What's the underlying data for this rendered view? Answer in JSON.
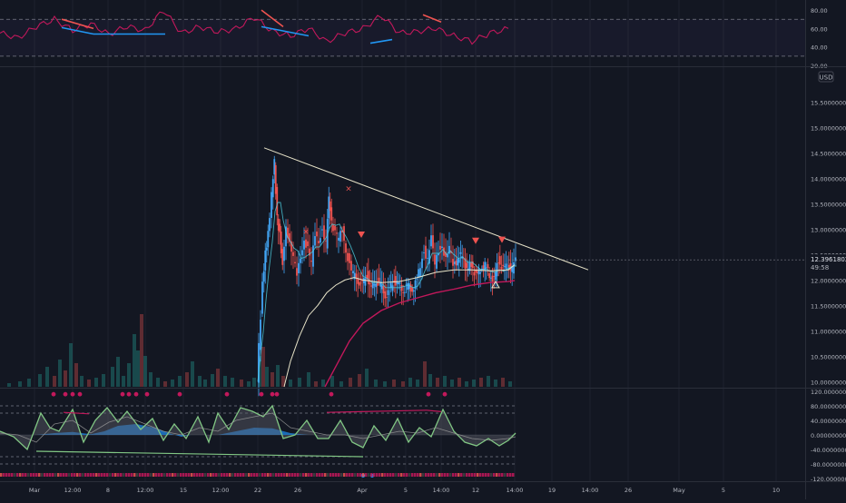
{
  "currency": "USD",
  "price_badge": {
    "price": "12.39618025",
    "countdown": "49:58"
  },
  "colors": {
    "background": "#131722",
    "grid": "#1e222d",
    "text": "#b2b5be",
    "up": "#26a69a",
    "down": "#ef5350",
    "rsi": "#c2185b",
    "div_bull": "#2196f3",
    "trendline": "#e8e4c9",
    "ma_slow": "#c2185b",
    "ma_mid": "#e8e4c9",
    "osc_green": "#81c784",
    "osc_blue": "#1e88e5",
    "price_badge": "#131722"
  },
  "chart_data": [
    {
      "type": "line",
      "panel": "rsi",
      "ylim": [
        20,
        85
      ],
      "y_ticks": [
        "80.00",
        "60.00",
        "40.00",
        "20.00"
      ],
      "levels": [
        70,
        30
      ],
      "x": [
        0,
        20,
        40,
        60,
        80,
        100,
        120,
        140,
        160,
        180,
        200,
        220,
        240,
        260,
        280,
        300,
        320,
        340,
        360,
        380,
        400,
        420,
        440,
        460,
        480,
        500,
        520,
        540,
        560
      ],
      "values": [
        55,
        50,
        62,
        70,
        58,
        65,
        54,
        62,
        58,
        80,
        55,
        62,
        56,
        60,
        72,
        57,
        52,
        60,
        46,
        55,
        60,
        74,
        55,
        57,
        60,
        52,
        46,
        55,
        60
      ],
      "divergences": [
        {
          "color": "bearish",
          "x": [
            68,
            103
          ],
          "values": [
            70,
            60
          ]
        },
        {
          "color": "bullish",
          "x": [
            68,
            103
          ],
          "values": [
            61,
            54
          ]
        },
        {
          "color": "bullish",
          "x": [
            103,
            182
          ],
          "values": [
            54,
            54
          ]
        },
        {
          "color": "bearish",
          "x": [
            288,
            312
          ],
          "values": [
            80,
            62
          ]
        },
        {
          "color": "bullish",
          "x": [
            288,
            340
          ],
          "values": [
            62,
            52
          ]
        },
        {
          "color": "bullish",
          "x": [
            408,
            432
          ],
          "values": [
            44,
            48
          ]
        },
        {
          "color": "bearish",
          "x": [
            466,
            486
          ],
          "values": [
            75,
            67
          ]
        }
      ]
    },
    {
      "type": "candlestick",
      "panel": "price",
      "ylim": [
        9.9,
        16.15
      ],
      "y_ticks": [
        "15.50000000",
        "15.00000000",
        "14.50000000",
        "14.00000000",
        "13.50000000",
        "13.00000000",
        "12.50000000",
        "12.00000000",
        "11.50000000",
        "11.00000000",
        "10.50000000",
        "10.00000000"
      ],
      "x_ticks": [
        {
          "label": "Mar",
          "x": 38
        },
        {
          "label": "12:00",
          "x": 80
        },
        {
          "label": "8",
          "x": 119
        },
        {
          "label": "12:00",
          "x": 160
        },
        {
          "label": "15",
          "x": 202
        },
        {
          "label": "12:00",
          "x": 243
        },
        {
          "label": "22",
          "x": 284
        },
        {
          "label": "26",
          "x": 328
        },
        {
          "label": "Apr",
          "x": 399
        },
        {
          "label": "5",
          "x": 447
        },
        {
          "label": "14:00",
          "x": 486
        },
        {
          "label": "12",
          "x": 524
        },
        {
          "label": "14:00",
          "x": 567
        },
        {
          "label": "19",
          "x": 608
        },
        {
          "label": "14:00",
          "x": 650
        },
        {
          "label": "26",
          "x": 692
        },
        {
          "label": "May",
          "x": 748
        },
        {
          "label": "5",
          "x": 797
        },
        {
          "label": "10",
          "x": 855
        }
      ],
      "price_path": {
        "x": [
          284,
          286,
          288,
          290,
          293,
          296,
          300,
          303,
          306,
          309,
          312,
          316,
          320,
          324,
          328,
          332,
          336,
          340,
          344,
          348,
          352,
          356,
          360,
          363,
          366,
          370,
          374,
          378,
          382,
          386,
          390,
          395,
          400,
          405,
          410,
          415,
          420,
          425,
          430,
          435,
          440,
          445,
          450,
          455,
          460,
          464,
          468,
          472,
          476,
          480,
          484,
          488,
          492,
          496,
          500,
          505,
          510,
          515,
          520,
          525,
          530,
          535,
          540,
          545,
          550,
          555,
          560,
          565,
          569
        ],
        "values": [
          10.0,
          10.7,
          11.3,
          11.9,
          12.5,
          12.9,
          13.7,
          14.3,
          13.2,
          12.9,
          12.3,
          13.1,
          12.7,
          12.4,
          12.1,
          12.5,
          12.8,
          12.6,
          12.3,
          12.9,
          12.8,
          13.0,
          12.7,
          13.6,
          13.1,
          12.9,
          12.8,
          13.0,
          12.6,
          12.3,
          12.1,
          12.0,
          11.9,
          12.1,
          11.8,
          12.0,
          11.9,
          11.7,
          11.8,
          12.0,
          11.9,
          11.8,
          11.9,
          11.8,
          12.0,
          12.3,
          12.6,
          12.4,
          12.8,
          12.3,
          12.6,
          12.7,
          12.4,
          12.6,
          12.3,
          12.4,
          12.5,
          12.2,
          12.3,
          12.1,
          12.2,
          12.3,
          12.1,
          12.0,
          12.4,
          12.2,
          12.3,
          12.2,
          12.4
        ]
      },
      "ma_slow": {
        "x": [
          358,
          370,
          385,
          400,
          420,
          440,
          460,
          480,
          500,
          520,
          540,
          560,
          567
        ],
        "values": [
          9.9,
          10.3,
          10.8,
          11.15,
          11.4,
          11.55,
          11.65,
          11.75,
          11.82,
          11.9,
          11.95,
          11.97,
          11.99
        ]
      },
      "ma_mid": {
        "x": [
          313,
          320,
          330,
          340,
          350,
          360,
          370,
          380,
          390,
          400,
          420,
          440,
          460,
          480,
          500,
          520,
          540,
          560,
          567
        ],
        "values": [
          9.9,
          10.4,
          10.9,
          11.3,
          11.5,
          11.75,
          11.9,
          12.0,
          12.05,
          12.0,
          11.95,
          11.97,
          12.05,
          12.15,
          12.2,
          12.2,
          12.18,
          12.2,
          12.3
        ]
      },
      "trendline": {
        "x": [
          291,
          648
        ],
        "values": [
          14.6,
          12.2
        ]
      },
      "markers": [
        {
          "symbol": "x",
          "x": 337,
          "value": 12.95
        },
        {
          "symbol": "x",
          "x": 384,
          "value": 13.8
        },
        {
          "symbol": "triangle-down",
          "x": 398,
          "value": 12.9
        },
        {
          "symbol": "triangle-down",
          "x": 524,
          "value": 12.78
        },
        {
          "symbol": "triangle-down",
          "x": 553,
          "value": 12.8
        },
        {
          "symbol": "triangle-up",
          "x": 546,
          "value": 11.92
        }
      ],
      "volume": [
        {
          "x": 10,
          "h": 4
        },
        {
          "x": 22,
          "h": 6
        },
        {
          "x": 32,
          "h": 9
        },
        {
          "x": 44,
          "h": 14
        },
        {
          "x": 52,
          "h": 22
        },
        {
          "x": 60,
          "h": 12
        },
        {
          "x": 66,
          "h": 30
        },
        {
          "x": 72,
          "h": 18
        },
        {
          "x": 78,
          "h": 48
        },
        {
          "x": 84,
          "h": 26
        },
        {
          "x": 90,
          "h": 12
        },
        {
          "x": 98,
          "h": 8
        },
        {
          "x": 106,
          "h": 10
        },
        {
          "x": 114,
          "h": 14
        },
        {
          "x": 124,
          "h": 22
        },
        {
          "x": 130,
          "h": 33
        },
        {
          "x": 136,
          "h": 12
        },
        {
          "x": 142,
          "h": 26
        },
        {
          "x": 148,
          "h": 58
        },
        {
          "x": 152,
          "h": 40
        },
        {
          "x": 156,
          "h": 80
        },
        {
          "x": 160,
          "h": 34
        },
        {
          "x": 166,
          "h": 16
        },
        {
          "x": 174,
          "h": 10
        },
        {
          "x": 182,
          "h": 6
        },
        {
          "x": 190,
          "h": 8
        },
        {
          "x": 198,
          "h": 12
        },
        {
          "x": 206,
          "h": 16
        },
        {
          "x": 212,
          "h": 28
        },
        {
          "x": 220,
          "h": 12
        },
        {
          "x": 226,
          "h": 8
        },
        {
          "x": 234,
          "h": 14
        },
        {
          "x": 240,
          "h": 20
        },
        {
          "x": 248,
          "h": 12
        },
        {
          "x": 256,
          "h": 10
        },
        {
          "x": 266,
          "h": 8
        },
        {
          "x": 274,
          "h": 6
        },
        {
          "x": 280,
          "h": 10
        },
        {
          "x": 286,
          "h": 34
        },
        {
          "x": 290,
          "h": 44
        },
        {
          "x": 294,
          "h": 22
        },
        {
          "x": 300,
          "h": 16
        },
        {
          "x": 306,
          "h": 24
        },
        {
          "x": 312,
          "h": 12
        },
        {
          "x": 320,
          "h": 8
        },
        {
          "x": 330,
          "h": 10
        },
        {
          "x": 340,
          "h": 16
        },
        {
          "x": 348,
          "h": 6
        },
        {
          "x": 356,
          "h": 8
        },
        {
          "x": 366,
          "h": 12
        },
        {
          "x": 376,
          "h": 6
        },
        {
          "x": 386,
          "h": 10
        },
        {
          "x": 396,
          "h": 14
        },
        {
          "x": 404,
          "h": 20
        },
        {
          "x": 414,
          "h": 8
        },
        {
          "x": 424,
          "h": 6
        },
        {
          "x": 434,
          "h": 8
        },
        {
          "x": 444,
          "h": 6
        },
        {
          "x": 452,
          "h": 10
        },
        {
          "x": 460,
          "h": 8
        },
        {
          "x": 468,
          "h": 28
        },
        {
          "x": 474,
          "h": 14
        },
        {
          "x": 482,
          "h": 10
        },
        {
          "x": 490,
          "h": 12
        },
        {
          "x": 498,
          "h": 8
        },
        {
          "x": 506,
          "h": 10
        },
        {
          "x": 514,
          "h": 6
        },
        {
          "x": 522,
          "h": 8
        },
        {
          "x": 530,
          "h": 10
        },
        {
          "x": 538,
          "h": 12
        },
        {
          "x": 546,
          "h": 8
        },
        {
          "x": 554,
          "h": 10
        },
        {
          "x": 562,
          "h": 6
        }
      ]
    },
    {
      "type": "area",
      "panel": "oscillator",
      "ylim": [
        -125,
        125
      ],
      "y_ticks": [
        "120.00000000",
        "80.00000000",
        "40.00000000",
        "0.00000000",
        "-40.00000000",
        "-80.00000000",
        "-120.00000000"
      ],
      "levels": [
        80,
        60,
        -60,
        -80
      ],
      "wave": {
        "x": [
          0,
          15,
          30,
          45,
          55,
          65,
          80,
          92,
          105,
          118,
          130,
          140,
          155,
          168,
          180,
          192,
          205,
          218,
          230,
          240,
          252,
          265,
          278,
          290,
          300,
          312,
          325,
          338,
          350,
          362,
          375,
          388,
          400,
          412,
          425,
          438,
          450,
          462,
          475,
          488,
          500,
          512,
          525,
          538,
          550,
          560,
          568
        ],
        "values": [
          10,
          -5,
          -40,
          60,
          20,
          10,
          70,
          -20,
          40,
          75,
          35,
          65,
          15,
          45,
          -15,
          30,
          -10,
          50,
          -20,
          60,
          15,
          75,
          65,
          50,
          80,
          -10,
          0,
          40,
          -10,
          -10,
          40,
          -20,
          -35,
          25,
          -15,
          45,
          -20,
          20,
          -5,
          70,
          10,
          -20,
          -30,
          -10,
          -30,
          -15,
          5
        ]
      },
      "signal": {
        "x": [
          0,
          20,
          40,
          60,
          80,
          100,
          120,
          140,
          160,
          180,
          200,
          220,
          240,
          260,
          280,
          300,
          320,
          340,
          360,
          380,
          400,
          420,
          440,
          460,
          480,
          500,
          520,
          540,
          560,
          568
        ],
        "values": [
          5,
          0,
          -20,
          30,
          40,
          5,
          35,
          50,
          30,
          10,
          0,
          20,
          10,
          40,
          50,
          60,
          20,
          10,
          0,
          0,
          -10,
          0,
          10,
          5,
          20,
          5,
          -10,
          -15,
          -10,
          -5
        ]
      },
      "money_flow": {
        "x": [
          40,
          60,
          80,
          100,
          115,
          130,
          150,
          170,
          190,
          200,
          210,
          240,
          260,
          280,
          300,
          320,
          340,
          360,
          380,
          560
        ],
        "values": [
          0,
          5,
          8,
          2,
          10,
          25,
          30,
          20,
          2,
          -5,
          0,
          0,
          10,
          20,
          18,
          5,
          0,
          0,
          0,
          0
        ]
      },
      "divergences": [
        {
          "color": "bearish",
          "x": [
            70,
            98
          ],
          "values": [
            62,
            58
          ]
        },
        {
          "color": "bearish",
          "x": [
            360,
            470
          ],
          "values": [
            62,
            68
          ]
        },
        {
          "color": "bearish",
          "x": [
            470,
            486
          ],
          "values": [
            68,
            64
          ]
        },
        {
          "color": "bullish",
          "x": [
            40,
            400
          ],
          "values": [
            -45,
            -60
          ]
        }
      ],
      "top_dots": [
        59,
        72,
        80,
        88,
        135,
        142,
        150,
        162,
        198,
        250,
        288,
        300,
        305,
        365,
        472,
        490
      ],
      "bottom_dots": [
        400,
        410
      ]
    }
  ]
}
